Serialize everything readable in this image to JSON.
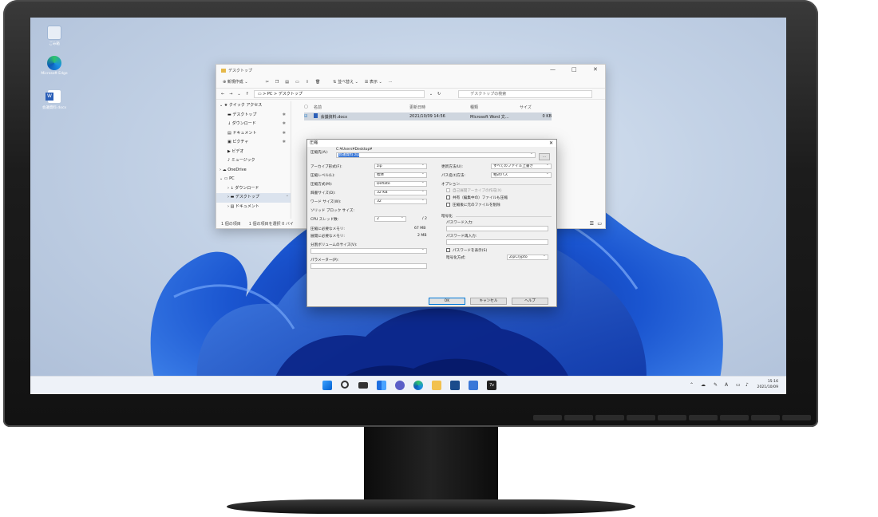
{
  "desktop": {
    "icons": [
      {
        "label": "ごみ箱",
        "icon": "recycle-bin-icon"
      },
      {
        "label": "Microsoft Edge",
        "icon": "edge-icon"
      },
      {
        "label": "会議資料.docx",
        "icon": "word-doc-icon"
      }
    ]
  },
  "explorer": {
    "title": "デスクトップ",
    "commands": {
      "new": "新規作成",
      "sort": "並べ替え",
      "view": "表示",
      "more": "···"
    },
    "address": {
      "path_root": "PC",
      "path_leaf": "デスクトップ",
      "search_placeholder": "デスクトップの検索"
    },
    "columns": [
      "名前",
      "更新日時",
      "種類",
      "サイズ"
    ],
    "files": [
      {
        "name": "会議資料.docx",
        "modified": "2021/10/09 14:56",
        "type": "Microsoft Word 文...",
        "size": "0 KB"
      }
    ],
    "nav": {
      "quick_access": "クイック アクセス",
      "items": [
        "デスクトップ",
        "ダウンロード",
        "ドキュメント",
        "ピクチャ",
        "ビデオ",
        "ミュージック"
      ],
      "onedrive": "OneDrive",
      "pc": "PC",
      "pc_items": [
        "ダウンロード",
        "デスクトップ",
        "ドキュメント"
      ]
    },
    "status": "1 個の項目　　1 個の項目を選択  0 バイ"
  },
  "dialog": {
    "title": "圧縮",
    "archive_label": "圧縮先(A):",
    "archive_path": "C:¥Users¥Desktop¥",
    "archive_name": "会議資料.zip",
    "browse_label": "...",
    "format_label": "アーカイブ形式(F):",
    "format_value": "zip",
    "level_label": "圧縮レベル(L):",
    "level_value": "標準",
    "method_label": "圧縮方式(M):",
    "method_value": "Deflate",
    "dict_label": "辞書サイズ(D):",
    "dict_value": "32 KB",
    "word_label": "ワード サイズ(W):",
    "word_value": "32",
    "solid_label": "ソリッド ブロック サイズ:",
    "threads_label": "CPU スレッド数:",
    "threads_value": "2",
    "threads_max": "/ 2",
    "mem_comp_label": "圧縮に必要なメモリ:",
    "mem_comp_value": "67 MB",
    "mem_decomp_label": "展開に必要なメモリ:",
    "mem_decomp_value": "2 MB",
    "split_label": "分割ボリュームのサイズ(V):",
    "params_label": "パラメーター(P):",
    "update_label": "更新方法(U):",
    "update_value": "すべてのファイル上書き",
    "pathmode_label": "パス名(t)方法:",
    "pathmode_value": "相対パス",
    "options_label": "オプション",
    "opt_sfx": "自己展開アーカイブの作成(X)",
    "opt_shared": "共有（編集中の）ファイルも圧縮",
    "opt_delete": "圧縮後に元のファイルを削除",
    "encrypt_label": "暗号化",
    "pwd_label": "パスワード入力:",
    "pwd2_label": "パスワード再入力:",
    "show_pwd_label": "パスワードを表示(S)",
    "enc_method_label": "暗号化方式:",
    "enc_method_value": "ZipCrypto",
    "ok": "OK",
    "cancel": "キャンセル",
    "help": "ヘルプ"
  },
  "taskbar": {
    "time": "15:16",
    "date": "2021/10/09"
  },
  "colors": {
    "accent": "#0078d7",
    "wallpaper_blue": "#1f5fd6",
    "bezel": "#1a1a1a"
  }
}
